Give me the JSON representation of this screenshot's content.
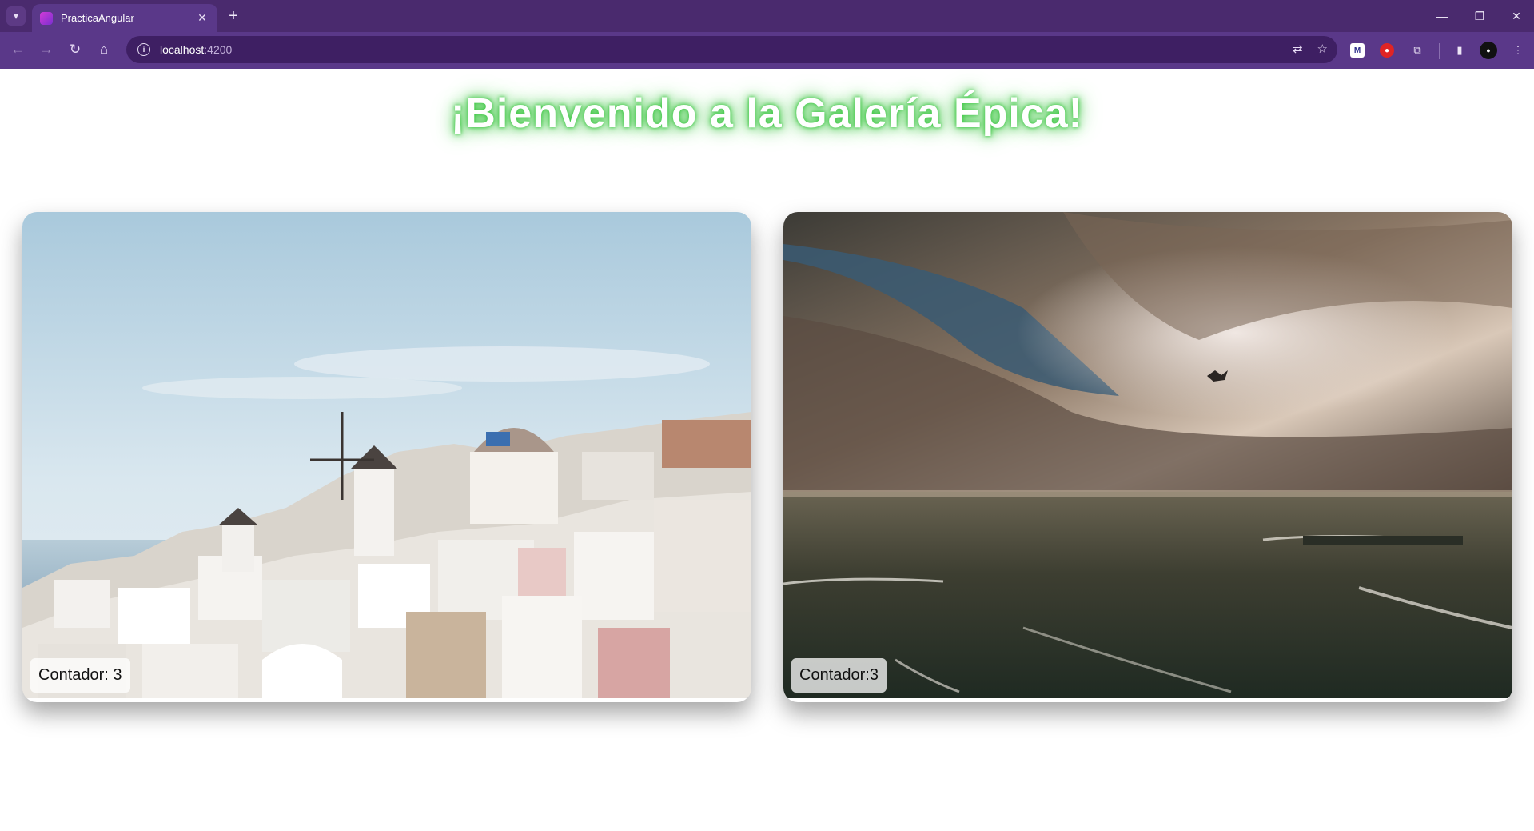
{
  "browser": {
    "tab_title": "PracticaAngular",
    "url_host": "localhost",
    "url_port": ":4200"
  },
  "page": {
    "title": "¡Bienvenido a la Galería Épica!"
  },
  "gallery": [
    {
      "subject": "santorini-village",
      "counter_label": "Contador: 3"
    },
    {
      "subject": "stormy-sea",
      "counter_label": "Contador:3"
    }
  ],
  "colors": {
    "tabbar": "#4a2a6e",
    "toolbar": "#5a3889",
    "omnibox": "#3e1f63",
    "title_glow": "#49c94f"
  }
}
